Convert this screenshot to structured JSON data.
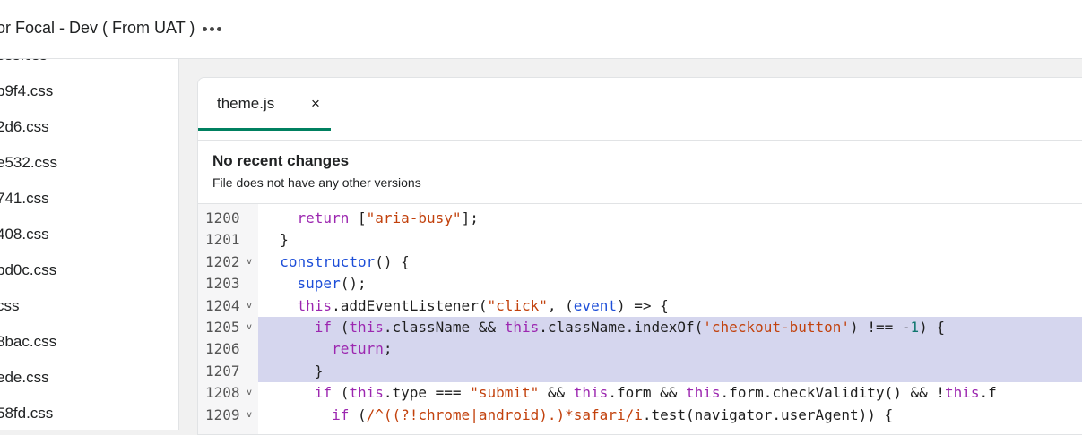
{
  "topbar": {
    "title": "or Focal - Dev ( From UAT )",
    "more_icon": "more-horizontal-icon"
  },
  "sidebar": {
    "files": [
      "ess.css",
      "b9f4.css",
      "2d6.css",
      "e532.css",
      "741.css",
      "408.css",
      "bd0c.css",
      "css",
      "8bac.css",
      "ede.css",
      "58fd.css"
    ]
  },
  "editor": {
    "tab": {
      "label": "theme.js",
      "close_label": "×"
    },
    "notice": {
      "title": "No recent changes",
      "subtitle": "File does not have any other versions"
    },
    "code_lines": [
      {
        "num": "1200",
        "fold": "",
        "segments": [
          {
            "t": "    "
          },
          {
            "t": "return",
            "c": "kw"
          },
          {
            "t": " ["
          },
          {
            "t": "\"aria-busy\"",
            "c": "str"
          },
          {
            "t": "];"
          }
        ]
      },
      {
        "num": "1201",
        "fold": "",
        "segments": [
          {
            "t": "  }"
          }
        ]
      },
      {
        "num": "1202",
        "fold": "v",
        "segments": [
          {
            "t": "  "
          },
          {
            "t": "constructor",
            "c": "kw2"
          },
          {
            "t": "() {"
          }
        ]
      },
      {
        "num": "1203",
        "fold": "",
        "segments": [
          {
            "t": "    "
          },
          {
            "t": "super",
            "c": "kw2"
          },
          {
            "t": "();"
          }
        ]
      },
      {
        "num": "1204",
        "fold": "v",
        "segments": [
          {
            "t": "    "
          },
          {
            "t": "this",
            "c": "kw"
          },
          {
            "t": ".addEventListener("
          },
          {
            "t": "\"click\"",
            "c": "str"
          },
          {
            "t": ", ("
          },
          {
            "t": "event",
            "c": "kw2"
          },
          {
            "t": ") => {"
          }
        ]
      },
      {
        "num": "1205",
        "fold": "v",
        "segments": [
          {
            "t": "      "
          },
          {
            "t": "if",
            "c": "kw"
          },
          {
            "t": " ("
          },
          {
            "t": "this",
            "c": "kw"
          },
          {
            "t": ".className && "
          },
          {
            "t": "this",
            "c": "kw"
          },
          {
            "t": ".className.indexOf("
          },
          {
            "t": "'checkout-button'",
            "c": "str"
          },
          {
            "t": ") !== -"
          },
          {
            "t": "1",
            "c": "num"
          },
          {
            "t": ") {"
          }
        ]
      },
      {
        "num": "1206",
        "fold": "",
        "segments": [
          {
            "t": "        "
          },
          {
            "t": "return",
            "c": "kw"
          },
          {
            "t": ";"
          }
        ]
      },
      {
        "num": "1207",
        "fold": "",
        "segments": [
          {
            "t": "      }"
          }
        ]
      },
      {
        "num": "1208",
        "fold": "v",
        "segments": [
          {
            "t": "      "
          },
          {
            "t": "if",
            "c": "kw"
          },
          {
            "t": " ("
          },
          {
            "t": "this",
            "c": "kw"
          },
          {
            "t": ".type === "
          },
          {
            "t": "\"submit\"",
            "c": "str"
          },
          {
            "t": " && "
          },
          {
            "t": "this",
            "c": "kw"
          },
          {
            "t": ".form && "
          },
          {
            "t": "this",
            "c": "kw"
          },
          {
            "t": ".form.checkValidity() && !"
          },
          {
            "t": "this",
            "c": "kw"
          },
          {
            "t": ".f"
          }
        ]
      },
      {
        "num": "1209",
        "fold": "v",
        "segments": [
          {
            "t": "        "
          },
          {
            "t": "if",
            "c": "kw"
          },
          {
            "t": " ("
          },
          {
            "t": "/^((?!chrome|android).)*safari/i",
            "c": "str"
          },
          {
            "t": ".test(navigator.userAgent)) {"
          }
        ]
      }
    ],
    "highlighted_lines": [
      "1205",
      "1206",
      "1207"
    ]
  },
  "colors": {
    "accent": "#008060",
    "highlight": "#d5d6ee",
    "keyword": "#9c27b0",
    "keyword_alt": "#1d4ed8",
    "string": "#c2410c"
  }
}
